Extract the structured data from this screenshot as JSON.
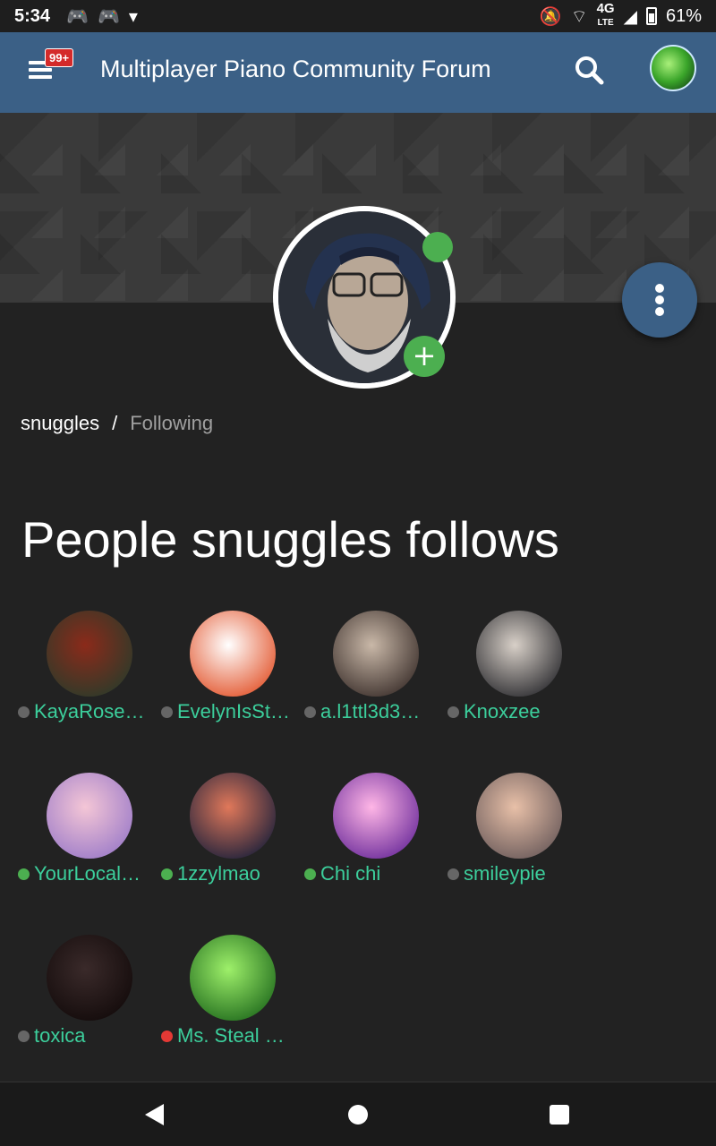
{
  "status_bar": {
    "time": "5:34",
    "network": "4G",
    "network_sub": "LTE",
    "battery": "61%"
  },
  "header": {
    "notification_badge": "99+",
    "title": "Multiplayer Piano Community Forum",
    "search_icon": "search-icon",
    "avatar_icon": "user-avatar"
  },
  "profile": {
    "status": "online",
    "status_color": "#4caf50",
    "follow_icon": "+"
  },
  "breadcrumb": {
    "user": "snuggles",
    "separator": "/",
    "current": "Following"
  },
  "page_title": "People snuggles follows",
  "users": [
    {
      "name": "KayaRose…",
      "presence": "offline",
      "avatar_colors": [
        "#8b2a1a",
        "#2a3b2a"
      ]
    },
    {
      "name": "EvelynIsSt…",
      "presence": "offline",
      "avatar_colors": [
        "#ffffff",
        "#e2532a"
      ]
    },
    {
      "name": "a.l1ttl3d3…",
      "presence": "offline",
      "avatar_colors": [
        "#c9b8a8",
        "#3a2e2a"
      ]
    },
    {
      "name": "Knoxzee",
      "presence": "offline",
      "avatar_colors": [
        "#d8d0c8",
        "#2a2a2e"
      ]
    },
    {
      "name": "YourLocal…",
      "presence": "online",
      "avatar_colors": [
        "#f4c6d6",
        "#9b7ac8"
      ]
    },
    {
      "name": "1zzylmao",
      "presence": "online",
      "avatar_colors": [
        "#e0785a",
        "#1a1f3a"
      ]
    },
    {
      "name": "Chi chi",
      "presence": "online",
      "avatar_colors": [
        "#ffb6e6",
        "#6a2a9a"
      ]
    },
    {
      "name": "smileypie",
      "presence": "offline",
      "avatar_colors": [
        "#e8c0a8",
        "#6a5a5a"
      ]
    },
    {
      "name": "toxica",
      "presence": "offline",
      "avatar_colors": [
        "#3a2a2a",
        "#120a0a"
      ]
    },
    {
      "name": "Ms. Steal …",
      "presence": "dnd",
      "avatar_colors": [
        "#9ef06a",
        "#1f6a1c"
      ]
    }
  ],
  "nav": {
    "back_icon": "back-icon",
    "home_icon": "home-icon",
    "recents_icon": "recents-icon"
  }
}
